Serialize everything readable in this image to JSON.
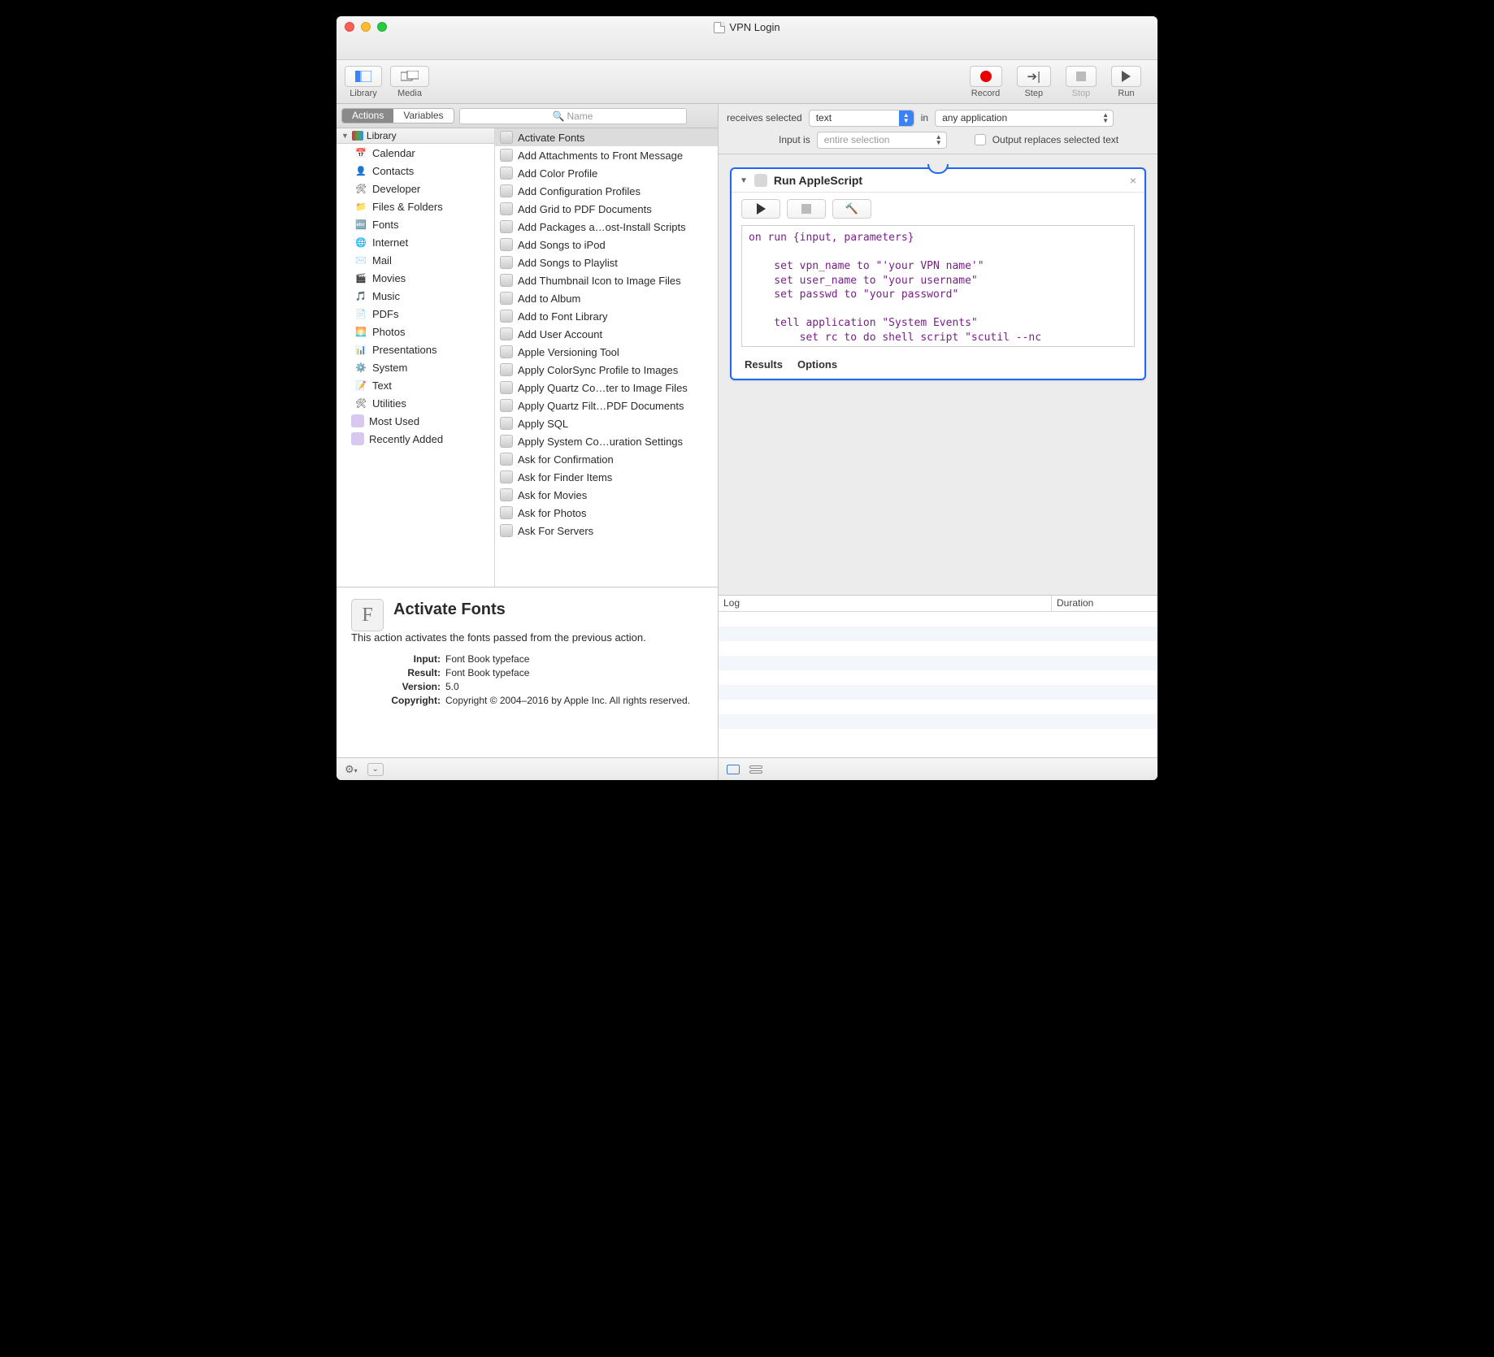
{
  "window": {
    "title": "VPN Login"
  },
  "toolbar": {
    "library": "Library",
    "media": "Media",
    "record": "Record",
    "step": "Step",
    "stop": "Stop",
    "run": "Run"
  },
  "segments": {
    "actions": "Actions",
    "variables": "Variables"
  },
  "search": {
    "placeholder": "Name"
  },
  "library": {
    "header": "Library",
    "items": [
      "Calendar",
      "Contacts",
      "Developer",
      "Files & Folders",
      "Fonts",
      "Internet",
      "Mail",
      "Movies",
      "Music",
      "PDFs",
      "Photos",
      "Presentations",
      "System",
      "Text",
      "Utilities"
    ],
    "smart": [
      "Most Used",
      "Recently Added"
    ]
  },
  "actions": {
    "selected_index": 0,
    "items": [
      "Activate Fonts",
      "Add Attachments to Front Message",
      "Add Color Profile",
      "Add Configuration Profiles",
      "Add Grid to PDF Documents",
      "Add Packages a…ost-Install Scripts",
      "Add Songs to iPod",
      "Add Songs to Playlist",
      "Add Thumbnail Icon to Image Files",
      "Add to Album",
      "Add to Font Library",
      "Add User Account",
      "Apple Versioning Tool",
      "Apply ColorSync Profile to Images",
      "Apply Quartz Co…ter to Image Files",
      "Apply Quartz Filt…PDF Documents",
      "Apply SQL",
      "Apply System Co…uration Settings",
      "Ask for Confirmation",
      "Ask for Finder Items",
      "Ask for Movies",
      "Ask for Photos",
      "Ask For Servers"
    ]
  },
  "description": {
    "title": "Activate Fonts",
    "body": "This action activates the fonts passed from the previous action.",
    "input_label": "Input:",
    "input_value": "Font Book typeface",
    "result_label": "Result:",
    "result_value": "Font Book typeface",
    "version_label": "Version:",
    "version_value": "5.0",
    "copyright_label": "Copyright:",
    "copyright_value": "Copyright © 2004–2016 by Apple Inc. All rights reserved."
  },
  "workflow": {
    "receives_label": "receives selected",
    "receives_value": "text",
    "in_label": "in",
    "in_value": "any application",
    "inputis_label": "Input is",
    "inputis_value": "entire selection",
    "output_replaces_label": "Output replaces selected text"
  },
  "action_card": {
    "title": "Run AppleScript",
    "code": "on run {input, parameters}\n\n    set vpn_name to \"'your VPN name'\"\n    set user_name to \"your username\"\n    set passwd to \"your password\"\n\n    tell application \"System Events\"\n        set rc to do shell script \"scutil --nc",
    "tab_results": "Results",
    "tab_options": "Options"
  },
  "log": {
    "col1": "Log",
    "col2": "Duration"
  }
}
